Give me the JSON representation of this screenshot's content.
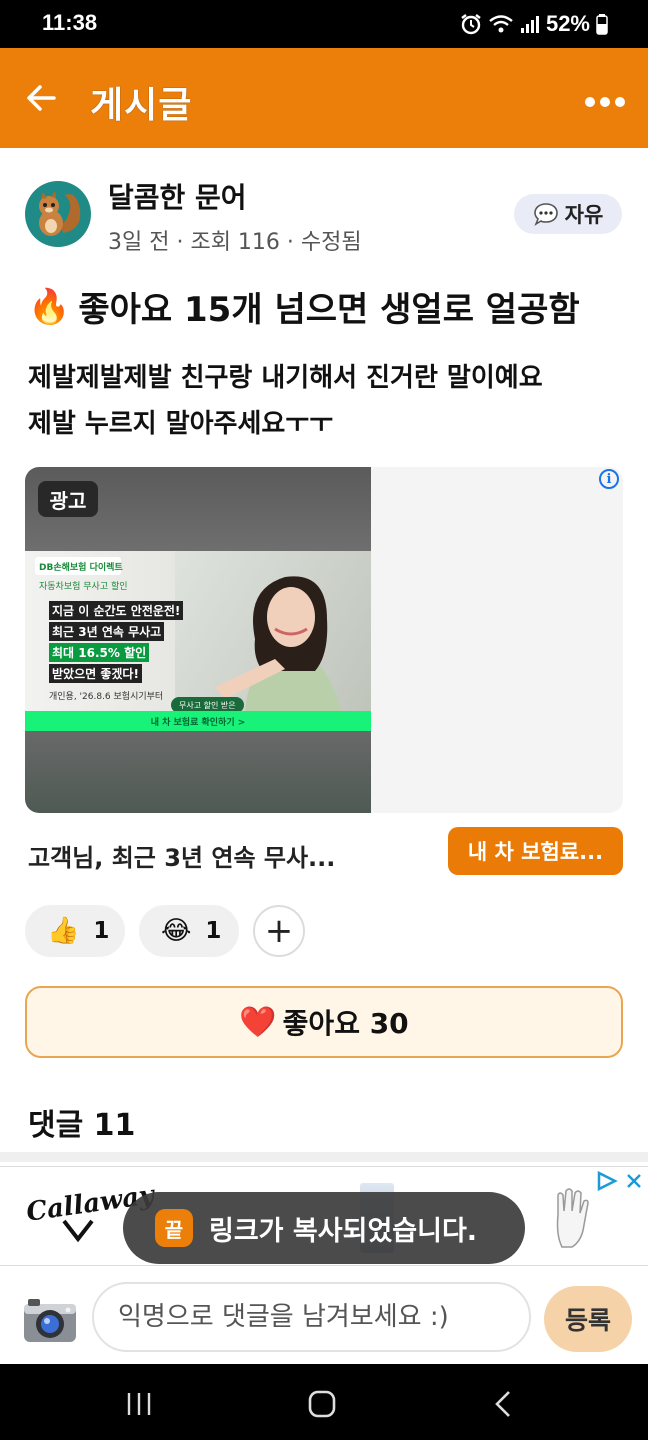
{
  "status_bar": {
    "time": "11:38",
    "battery": "52%"
  },
  "header": {
    "title": "게시글"
  },
  "post": {
    "author": "달콤한 문어",
    "meta": "3일 전 · 조회 116 · 수정됨",
    "category": "자유",
    "title_emoji": "🔥",
    "title": "좋아요 15개 넘으면 생얼로 얼공함",
    "body_lines": [
      "제발제발제발 친구랑 내기해서 진거란 말이예요",
      "제발 누르지 말아주세요ㅜㅜ"
    ]
  },
  "ad": {
    "badge": "광고",
    "info": "i",
    "banner": {
      "brand": "DB손해보험 다이렉트",
      "small_tag": "자동차보험 무사고 할인",
      "line1": "지금 이 순간도 안전운전!",
      "line2": "최근 3년 연속 무사고",
      "line3": "최대 16.5% 할인",
      "line4": "받았으면 좋겠다!",
      "note": "개인용, '26.8.6 보험시기부터",
      "pill": "무사고 할인 받은",
      "cta_strip": "내 차 보험료 확인하기 >"
    },
    "caption": "고객님, 최근 3년 연속 무사...",
    "cta": "내 차 보험료..."
  },
  "reactions": [
    {
      "emoji": "👍",
      "count": "1"
    },
    {
      "emoji": "😂",
      "count": "1"
    }
  ],
  "add_reaction": "+",
  "like": {
    "emoji": "❤️",
    "label": "좋아요 30"
  },
  "comments": {
    "header": "댓글 11"
  },
  "banner_ad": {
    "brand": "Callaway"
  },
  "toast": {
    "icon": "끝",
    "text": "링크가 복사되었습니다."
  },
  "comment_bar": {
    "placeholder": "익명으로 댓글을 남겨보세요 :)",
    "submit": "등록"
  },
  "icons": {
    "back": "back-arrow-icon",
    "more": "more-icon",
    "camera": "camera-icon",
    "chat": "chat-icon"
  },
  "colors": {
    "accent": "#ec7f0a",
    "like_bg": "#fff6e7",
    "like_border": "#eaa550"
  }
}
